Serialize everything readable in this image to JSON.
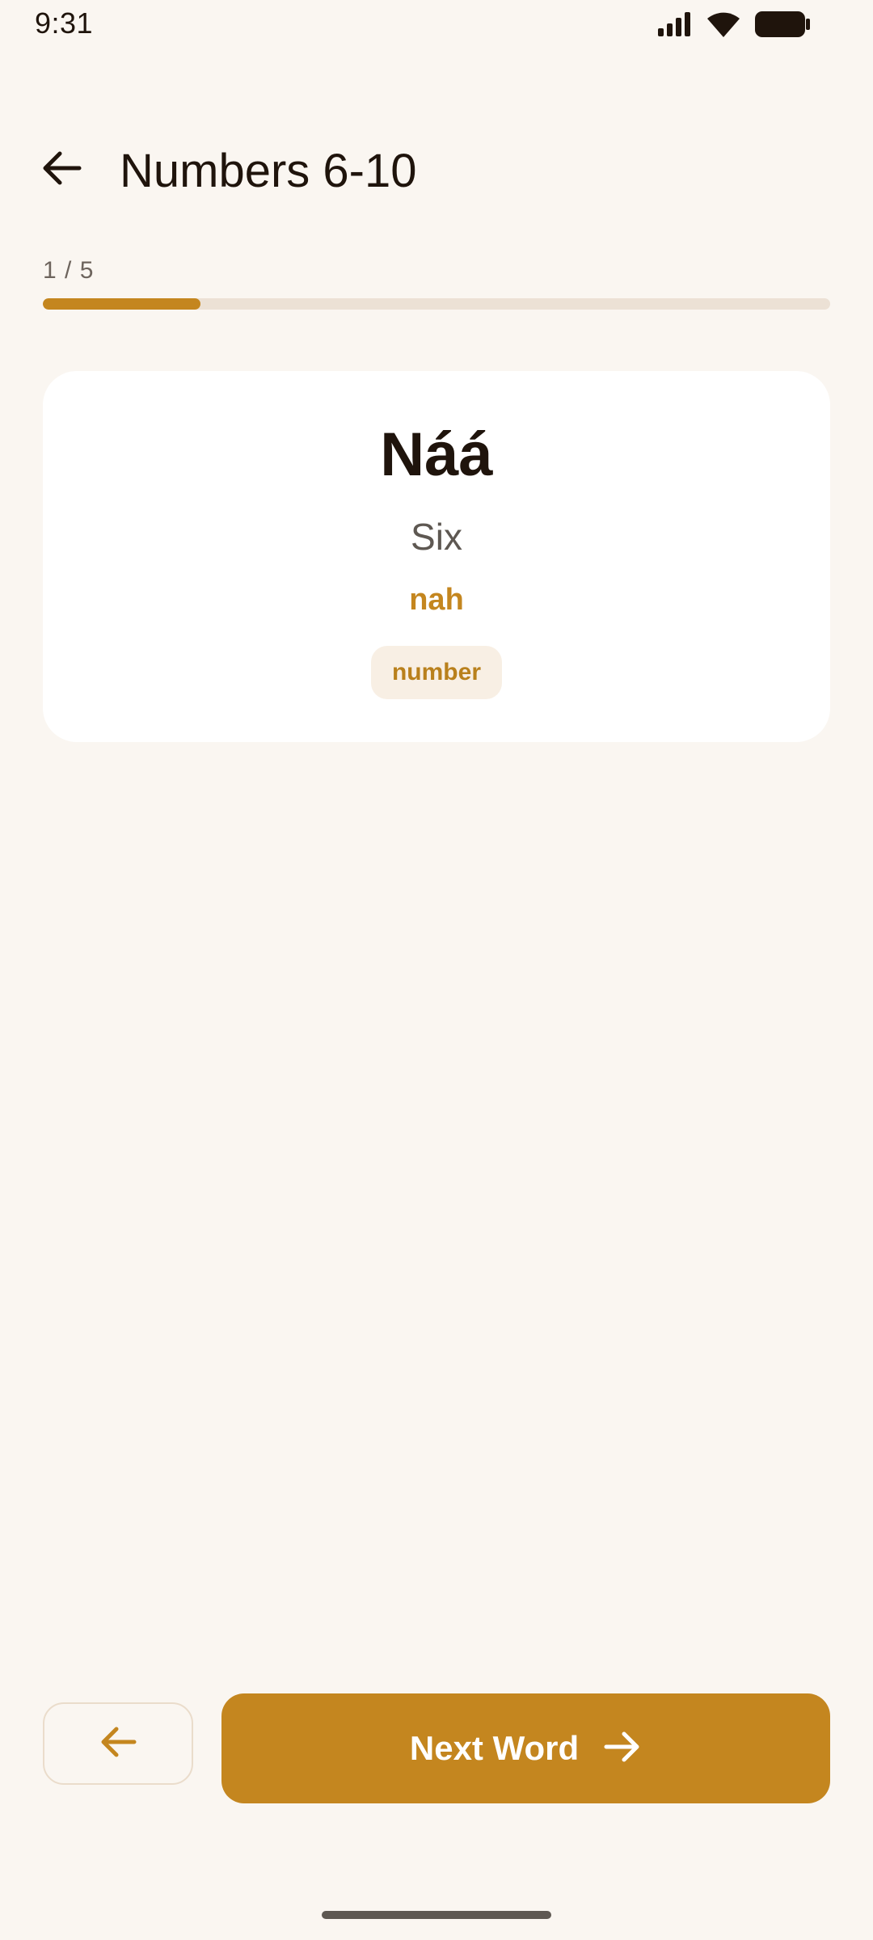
{
  "status_bar": {
    "time": "9:31",
    "icons": [
      "signal-icon",
      "wifi-icon",
      "battery-icon"
    ]
  },
  "header": {
    "back_icon": "arrow-left-icon",
    "title": "Numbers 6-10"
  },
  "progress": {
    "label": "1 / 5",
    "current": 1,
    "total": 5,
    "fraction": 0.2
  },
  "card": {
    "native_word": "Náá",
    "english": "Six",
    "pronunciation": "nah",
    "tag": "number"
  },
  "nav": {
    "prev_icon": "arrow-left-icon",
    "next_label": "Next Word",
    "next_icon": "arrow-right-icon"
  },
  "colors": {
    "background": "#faf6f1",
    "accent": "#c4861f",
    "card": "#ffffff",
    "text_primary": "#1f140c",
    "text_secondary": "#5e5852",
    "track": "#ece1d5",
    "tag_bg": "#f8efe4"
  }
}
